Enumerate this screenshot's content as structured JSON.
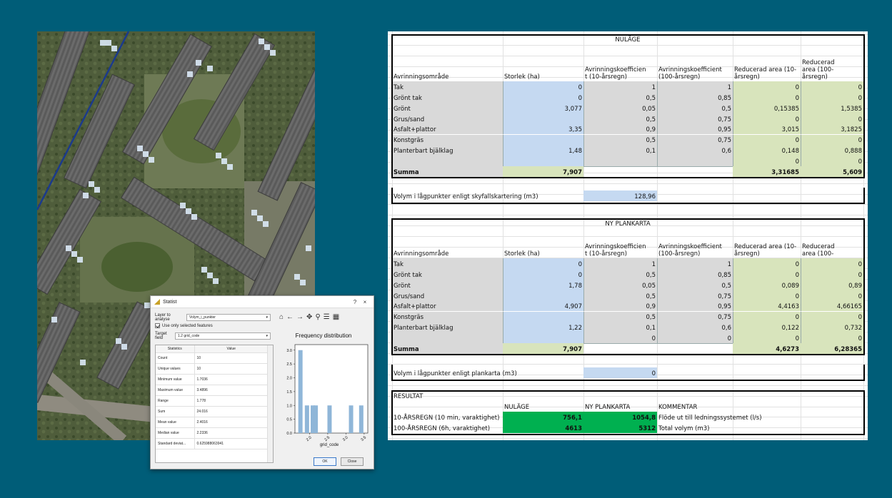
{
  "statistics_dialog": {
    "title": "Statist",
    "title_buttons": [
      "?",
      "×"
    ],
    "layer_label": "Layer to analyse",
    "layer_value": "Volym_i_punkter",
    "selected_checkbox_label": "Use only selected features",
    "field_label": "Target field",
    "field_value": "1.2 grid_code",
    "table_headers": [
      "Statistics",
      "Value"
    ],
    "rows": [
      {
        "stat": "Count",
        "value": "10"
      },
      {
        "stat": "Unique values",
        "value": "10"
      },
      {
        "stat": "Minimum value",
        "value": "1.7036"
      },
      {
        "stat": "Maximum value",
        "value": "3.4896"
      },
      {
        "stat": "Range",
        "value": "1.778"
      },
      {
        "stat": "Sum",
        "value": "24.016"
      },
      {
        "stat": "Mean value",
        "value": "2.4016"
      },
      {
        "stat": "Median value",
        "value": "2.2336"
      },
      {
        "stat": "Standard deviat...",
        "value": "0.625988063941"
      }
    ],
    "toolbar_icons": [
      "home-icon",
      "back-arrow-icon",
      "forward-arrow-icon",
      "pan-icon",
      "zoom-icon",
      "sliders-icon",
      "grid-icon"
    ],
    "ok_label": "OK",
    "close_label": "Close"
  },
  "chart_data": {
    "type": "bar",
    "title": "Frequency distribution",
    "xlabel": "grid_code",
    "ylabel": "",
    "xlim": [
      1.6,
      3.6
    ],
    "ylim": [
      0,
      3.2
    ],
    "x_ticks": [
      "2.0",
      "2.5",
      "3.0",
      "3.5"
    ],
    "y_ticks": [
      "0.0",
      "0.5",
      "1.0",
      "1.5",
      "2.0",
      "2.5",
      "3.0"
    ],
    "bars": [
      {
        "x": 1.75,
        "value": 3
      },
      {
        "x": 1.93,
        "value": 1
      },
      {
        "x": 2.09,
        "value": 1
      },
      {
        "x": 2.17,
        "value": 1
      },
      {
        "x": 2.55,
        "value": 1
      },
      {
        "x": 3.14,
        "value": 1
      },
      {
        "x": 3.42,
        "value": 1
      }
    ],
    "color": "#8fb6d8"
  },
  "sheet": {
    "nulage": {
      "title": "NULÄGE",
      "headers": [
        "Avrinningsområde",
        "Storlek (ha)",
        "Avrinningskoefficient (10-årsregn)",
        "Avrinningskoefficient (100-årsregn)",
        "Reducerad area (10-årsregn)",
        "Reducerad area (100-årsregn)"
      ],
      "header_lines": [
        [
          "Avrinningsområde"
        ],
        [
          "Storlek (ha)"
        ],
        [
          "Avrinningskoefficien",
          "t (10-årsregn)"
        ],
        [
          "Avrinningskoefficient",
          "(100-årsregn)"
        ],
        [
          "Reducerad area (10-",
          "årsregn)"
        ],
        [
          "Reducerad",
          "area (100-",
          "årsregn)"
        ]
      ],
      "rows": [
        [
          "Tak",
          "0",
          "1",
          "1",
          "0",
          "0"
        ],
        [
          "Grönt tak",
          "0",
          "0,5",
          "0,85",
          "0",
          "0"
        ],
        [
          "Grönt",
          "3,077",
          "0,05",
          "0,5",
          "0,15385",
          "1,5385"
        ],
        [
          "Grus/sand",
          "",
          "0,5",
          "0,75",
          "0",
          "0"
        ],
        [
          "Asfalt+plattor",
          "3,35",
          "0,9",
          "0,95",
          "3,015",
          "3,1825"
        ],
        [
          "Konstgräs",
          "",
          "0,5",
          "0,75",
          "0",
          "0"
        ],
        [
          "Planterbart bjälklag",
          "1,48",
          "0,1",
          "0,6",
          "0,148",
          "0,888"
        ],
        [
          "",
          "",
          "",
          "",
          "0",
          "0"
        ]
      ],
      "summa": [
        "Summa",
        "7,907",
        "",
        "",
        "3,31685",
        "5,609"
      ],
      "volume_label": "Volym i lågpunkter enligt skyfallskartering (m3)",
      "volume_value": "128,96"
    },
    "ny_plankarta": {
      "title": "NY PLANKARTA",
      "header_lines": [
        [
          "Avrinningsområde"
        ],
        [
          "Storlek (ha)"
        ],
        [
          "Avrinningskoefficien",
          "t (10-årsregn)"
        ],
        [
          "Avrinningskoefficient",
          "(100-årsregn)"
        ],
        [
          "Reducerad area (10-",
          "årsregn)"
        ],
        [
          "Reducerad",
          "area (100-"
        ]
      ],
      "rows": [
        [
          "Tak",
          "0",
          "1",
          "1",
          "0",
          "0"
        ],
        [
          "Grönt tak",
          "0",
          "0,5",
          "0,85",
          "0",
          "0"
        ],
        [
          "Grönt",
          "1,78",
          "0,05",
          "0,5",
          "0,089",
          "0,89"
        ],
        [
          "Grus/sand",
          "",
          "0,5",
          "0,75",
          "0",
          "0"
        ],
        [
          "Asfalt+plattor",
          "4,907",
          "0,9",
          "0,95",
          "4,4163",
          "4,66165"
        ],
        [
          "Konstgräs",
          "",
          "0,5",
          "0,75",
          "0",
          "0"
        ],
        [
          "Planterbart bjälklag",
          "1,22",
          "0,1",
          "0,6",
          "0,122",
          "0,732"
        ],
        [
          "",
          "",
          "0",
          "0",
          "0",
          "0"
        ]
      ],
      "summa": [
        "Summa",
        "7,907",
        "",
        "",
        "4,6273",
        "6,28365"
      ],
      "volume_label": "Volym i lågpunkter enligt plankarta (m3)",
      "volume_value": "0"
    },
    "resultat": {
      "title": "RESULTAT",
      "headers": [
        "NULÄGE",
        "NY PLANKARTA",
        "KOMMENTAR"
      ],
      "rows": [
        [
          "10-ÅRSREGN (10 min, varaktighet)",
          "756,1",
          "1054,8",
          "Flöde ut till ledningssystemet (l/s)"
        ],
        [
          "100-ÅRSREGN (6h, varaktighet)",
          "4613",
          "5312",
          "Total volym (m3)"
        ]
      ]
    },
    "colors": {
      "input_blue": "#c5d9f1",
      "gray": "#d9d9d9",
      "green_light": "#d8e4bc",
      "green_bright": "#00b050"
    }
  }
}
